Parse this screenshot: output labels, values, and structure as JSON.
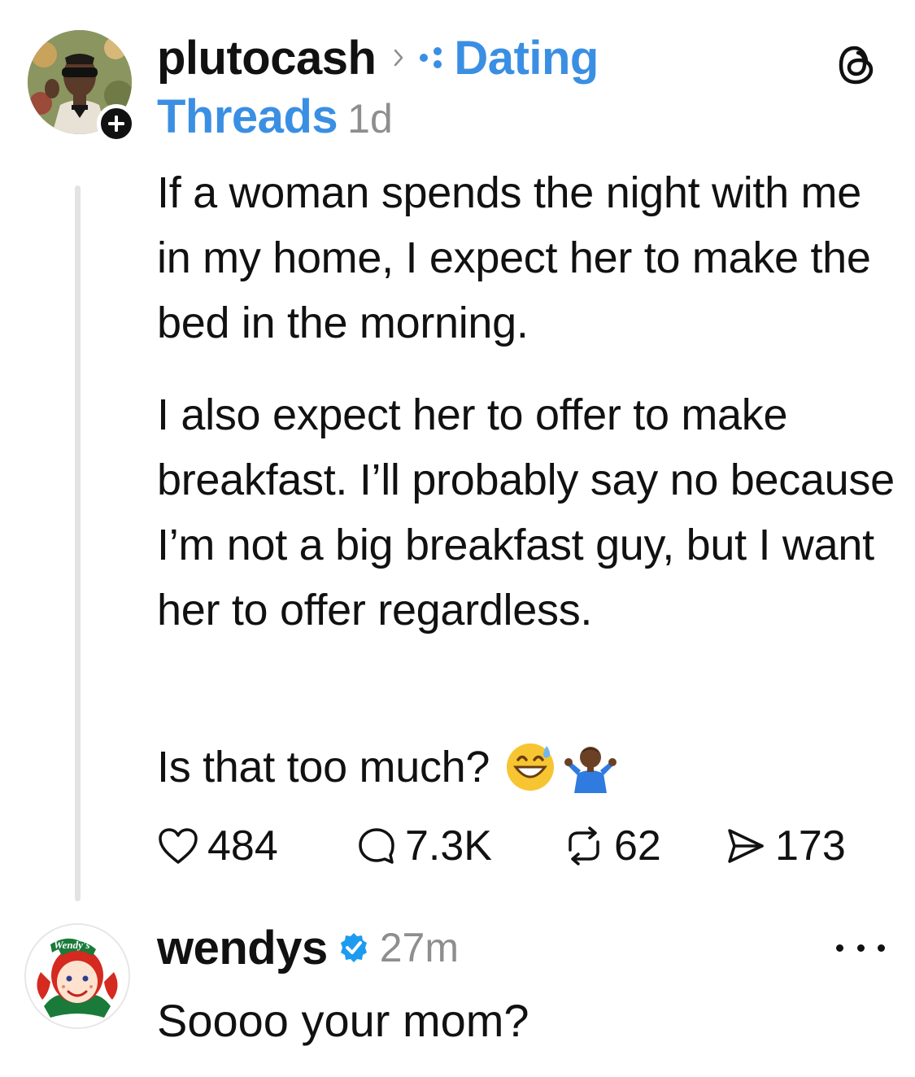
{
  "post": {
    "username": "plutocash",
    "community_line1": "Dating",
    "community_line2": "Threads",
    "time": "1d",
    "paragraphs": [
      "If a woman spends the night with me in my home, I expect her to make the bed in the morning.",
      "I also expect her to offer to make breakfast. I’ll probably say no because I’m not a big breakfast guy, but I want her to offer regardless.",
      "Is that too much?"
    ],
    "emojis": [
      "grinning-sweat-emoji",
      "person-shrugging-emoji"
    ],
    "stats": {
      "likes": "484",
      "replies": "7.3K",
      "reposts": "62",
      "shares": "173"
    },
    "icons": [
      "threads-logo-icon",
      "chevron-right-icon",
      "community-dots-icon",
      "follow-plus-icon",
      "heart-icon",
      "comment-icon",
      "repost-icon",
      "share-icon"
    ]
  },
  "reply": {
    "username": "wendys",
    "time": "27m",
    "text": "Soooo your mom?",
    "avatar_logo_text": "Wendy's",
    "icons": [
      "verified-badge-icon",
      "more-options-icon"
    ]
  },
  "colors": {
    "community_blue": "#3a8fe3",
    "verified_blue": "#1d9bf0",
    "muted_gray": "#8e8e8e",
    "thread_line": "#e3e3e3"
  }
}
